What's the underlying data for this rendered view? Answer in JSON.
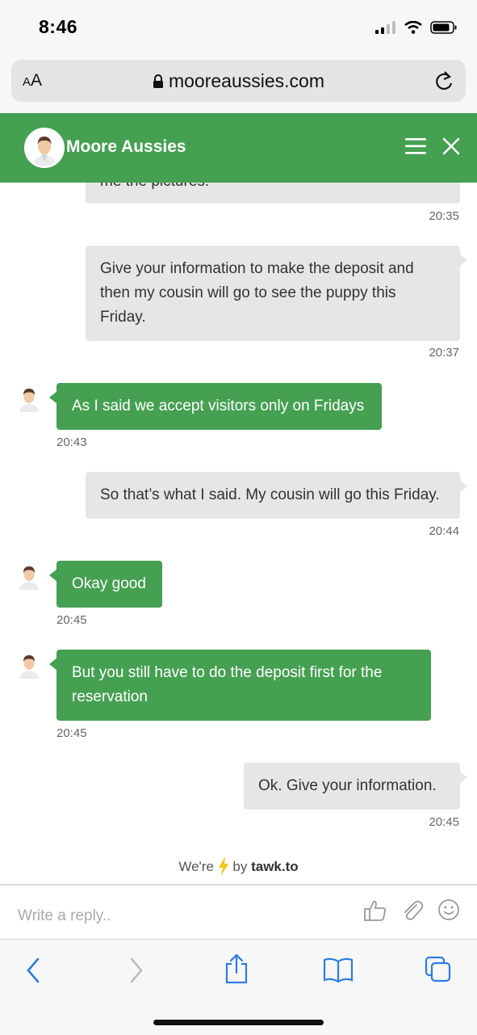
{
  "status_bar": {
    "time": "8:46"
  },
  "browser": {
    "text_size_label_small": "A",
    "text_size_label": "A",
    "url": "mooreaussies.com"
  },
  "chat_header": {
    "title": "Moore Aussies"
  },
  "messages": [
    {
      "sender": "visitor",
      "text": "me the pictures.",
      "time": "20:35"
    },
    {
      "sender": "visitor",
      "text": "Give your information to make the deposit and then my cousin will go to see the puppy this Friday.",
      "time": "20:37"
    },
    {
      "sender": "agent",
      "text": "As I said we accept visitors only on Fridays",
      "time": "20:43"
    },
    {
      "sender": "visitor",
      "text": "So that’s what I said. My cousin will go this Friday.",
      "time": "20:44"
    },
    {
      "sender": "agent",
      "text": "Okay good",
      "time": "20:45"
    },
    {
      "sender": "agent",
      "text": "But you still have to do the deposit first for the reservation",
      "time": "20:45"
    },
    {
      "sender": "visitor",
      "text": "Ok. Give your information.",
      "time": "20:45"
    }
  ],
  "branding": {
    "prefix": "We're",
    "by": "by",
    "name": "tawk.to"
  },
  "composer": {
    "placeholder": "Write a reply.."
  },
  "colors": {
    "accent": "#45a052",
    "visitor_bubble": "#e6e6e6",
    "ios_blue": "#2d7de0"
  },
  "icons": [
    "lock-icon",
    "reload-icon",
    "menu-icon",
    "close-icon",
    "thumbs-up-icon",
    "attachment-icon",
    "emoji-icon",
    "back-icon",
    "forward-icon",
    "share-icon",
    "bookmarks-icon",
    "tabs-icon"
  ]
}
